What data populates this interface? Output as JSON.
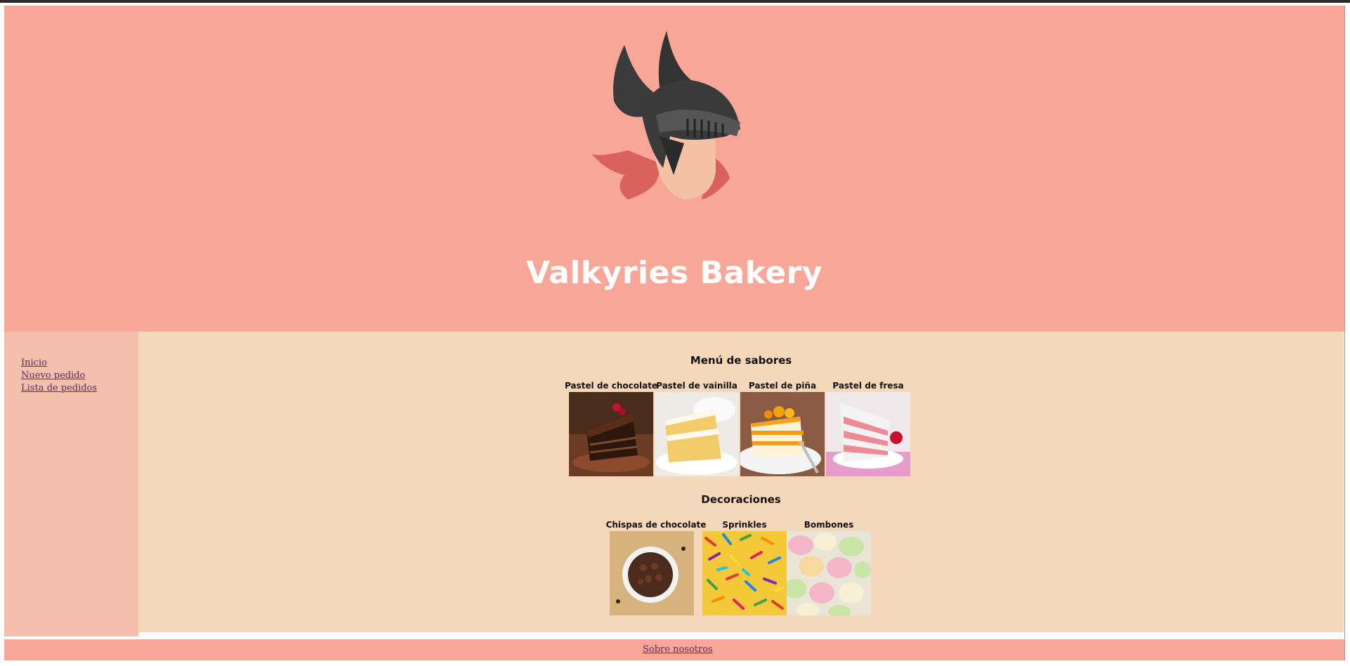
{
  "header": {
    "title": "Valkyries Bakery",
    "logo_icon": "valkyrie-helmet-icon"
  },
  "sidebar": {
    "items": [
      {
        "label": "Inicio"
      },
      {
        "label": "Nuevo pedido"
      },
      {
        "label": "Lista de pedidos"
      }
    ]
  },
  "flavors": {
    "title": "Menú de sabores",
    "items": [
      {
        "label": "Pastel de chocolate",
        "image": "chocolate-cake-image"
      },
      {
        "label": "Pastel de vainilla",
        "image": "vanilla-cake-image"
      },
      {
        "label": "Pastel de piña",
        "image": "pineapple-cake-image"
      },
      {
        "label": "Pastel de fresa",
        "image": "strawberry-cake-image"
      }
    ]
  },
  "decorations": {
    "title": "Decoraciones",
    "items": [
      {
        "label": "Chispas de chocolate",
        "image": "chocolate-chips-image"
      },
      {
        "label": "Sprinkles",
        "image": "sprinkles-image"
      },
      {
        "label": "Bombones",
        "image": "marshmallows-image"
      }
    ]
  },
  "footer": {
    "link": "Sobre nosotros"
  },
  "colors": {
    "header_bg": "#f7a698",
    "sidebar_bg": "#f4bfac",
    "main_bg": "#f5d8b9",
    "link": "#5a2a6e"
  }
}
